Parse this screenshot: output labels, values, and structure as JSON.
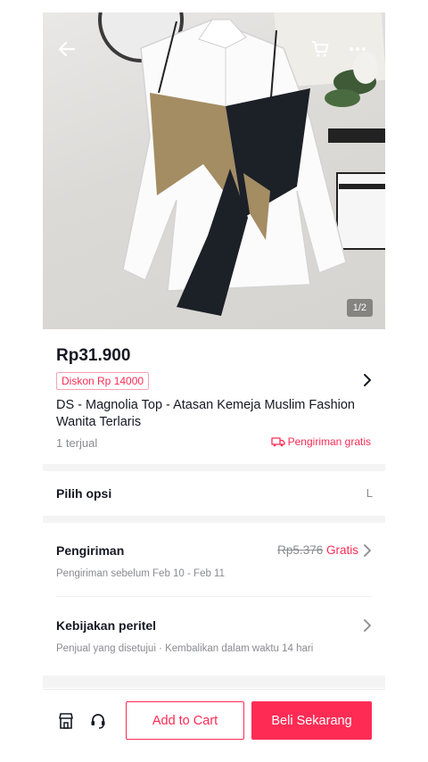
{
  "product_image": {
    "counter": "1/2"
  },
  "product": {
    "price": "Rp31.900",
    "discount": "Diskon Rp 14000",
    "title": "DS - Magnolia Top - Atasan Kemeja Muslim Fashion Wanita Terlaris",
    "sold": "1 terjual",
    "free_shipping": "Pengiriman gratis"
  },
  "options": {
    "label": "Pilih opsi",
    "value": "L"
  },
  "shipping": {
    "label": "Pengiriman",
    "old_price": "Rp5.376",
    "price": "Gratis",
    "estimate": "Pengiriman sebelum Feb 10 - Feb 11"
  },
  "policy": {
    "label": "Kebijakan peritel",
    "detail": "Penjual yang disetujui · Kembalikan dalam waktu 14 hari"
  },
  "actions": {
    "add_to_cart": "Add to Cart",
    "buy_now": "Beli Sekarang"
  },
  "colors": {
    "accent": "#fe2c55",
    "text": "#161823",
    "muted": "#8a8b91"
  }
}
